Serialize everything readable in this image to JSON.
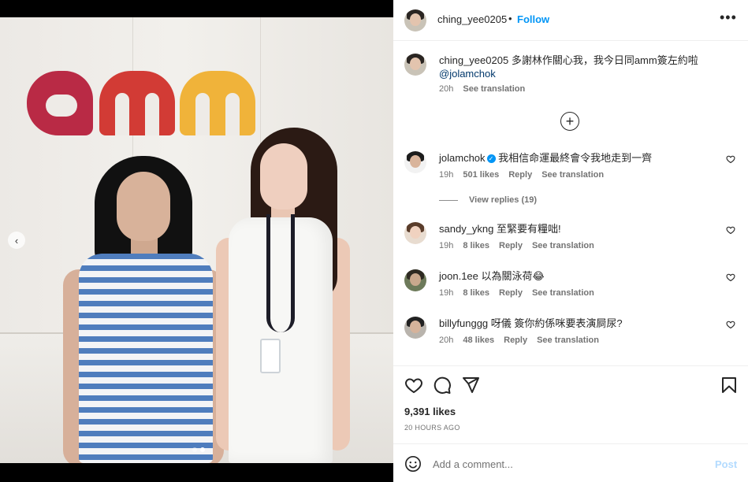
{
  "post": {
    "logo_text": "amm"
  },
  "header": {
    "username": "ching_yee0205",
    "separator": "•",
    "follow_label": "Follow",
    "more_label": "•••"
  },
  "caption": {
    "username": "ching_yee0205",
    "text": "多謝林作關心我，我今日同amm簽左約啦",
    "mention": "@jolamchok",
    "time": "20h",
    "translation_label": "See translation"
  },
  "comments": [
    {
      "username": "jolamchok",
      "verified": true,
      "text": "我相信命運最終會令我地走到一齊",
      "time": "19h",
      "likes": "501 likes",
      "reply_label": "Reply",
      "translation_label": "See translation",
      "view_replies": "View replies (19)"
    },
    {
      "username": "sandy_ykng",
      "text": "至緊要有糧咄!",
      "time": "19h",
      "likes": "8 likes",
      "reply_label": "Reply",
      "translation_label": "See translation"
    },
    {
      "username": "joon.1ee",
      "text": "以為關泳荷😂",
      "time": "19h",
      "likes": "8 likes",
      "reply_label": "Reply",
      "translation_label": "See translation"
    },
    {
      "username": "billyfunggg",
      "text": "呀儀 簽你約係咪要表演屙尿?",
      "time": "20h",
      "likes": "48 likes",
      "reply_label": "Reply",
      "translation_label": "See translation"
    }
  ],
  "stats": {
    "likes": "9,391 likes",
    "time_ago": "20 HOURS AGO"
  },
  "composer": {
    "placeholder": "Add a comment...",
    "post_label": "Post"
  },
  "colors": {
    "accent": "#0095f6",
    "post_disabled": "#b3dbff",
    "muted": "#737373"
  },
  "carousel": {
    "total_slides": 2,
    "active_slide": 2
  }
}
